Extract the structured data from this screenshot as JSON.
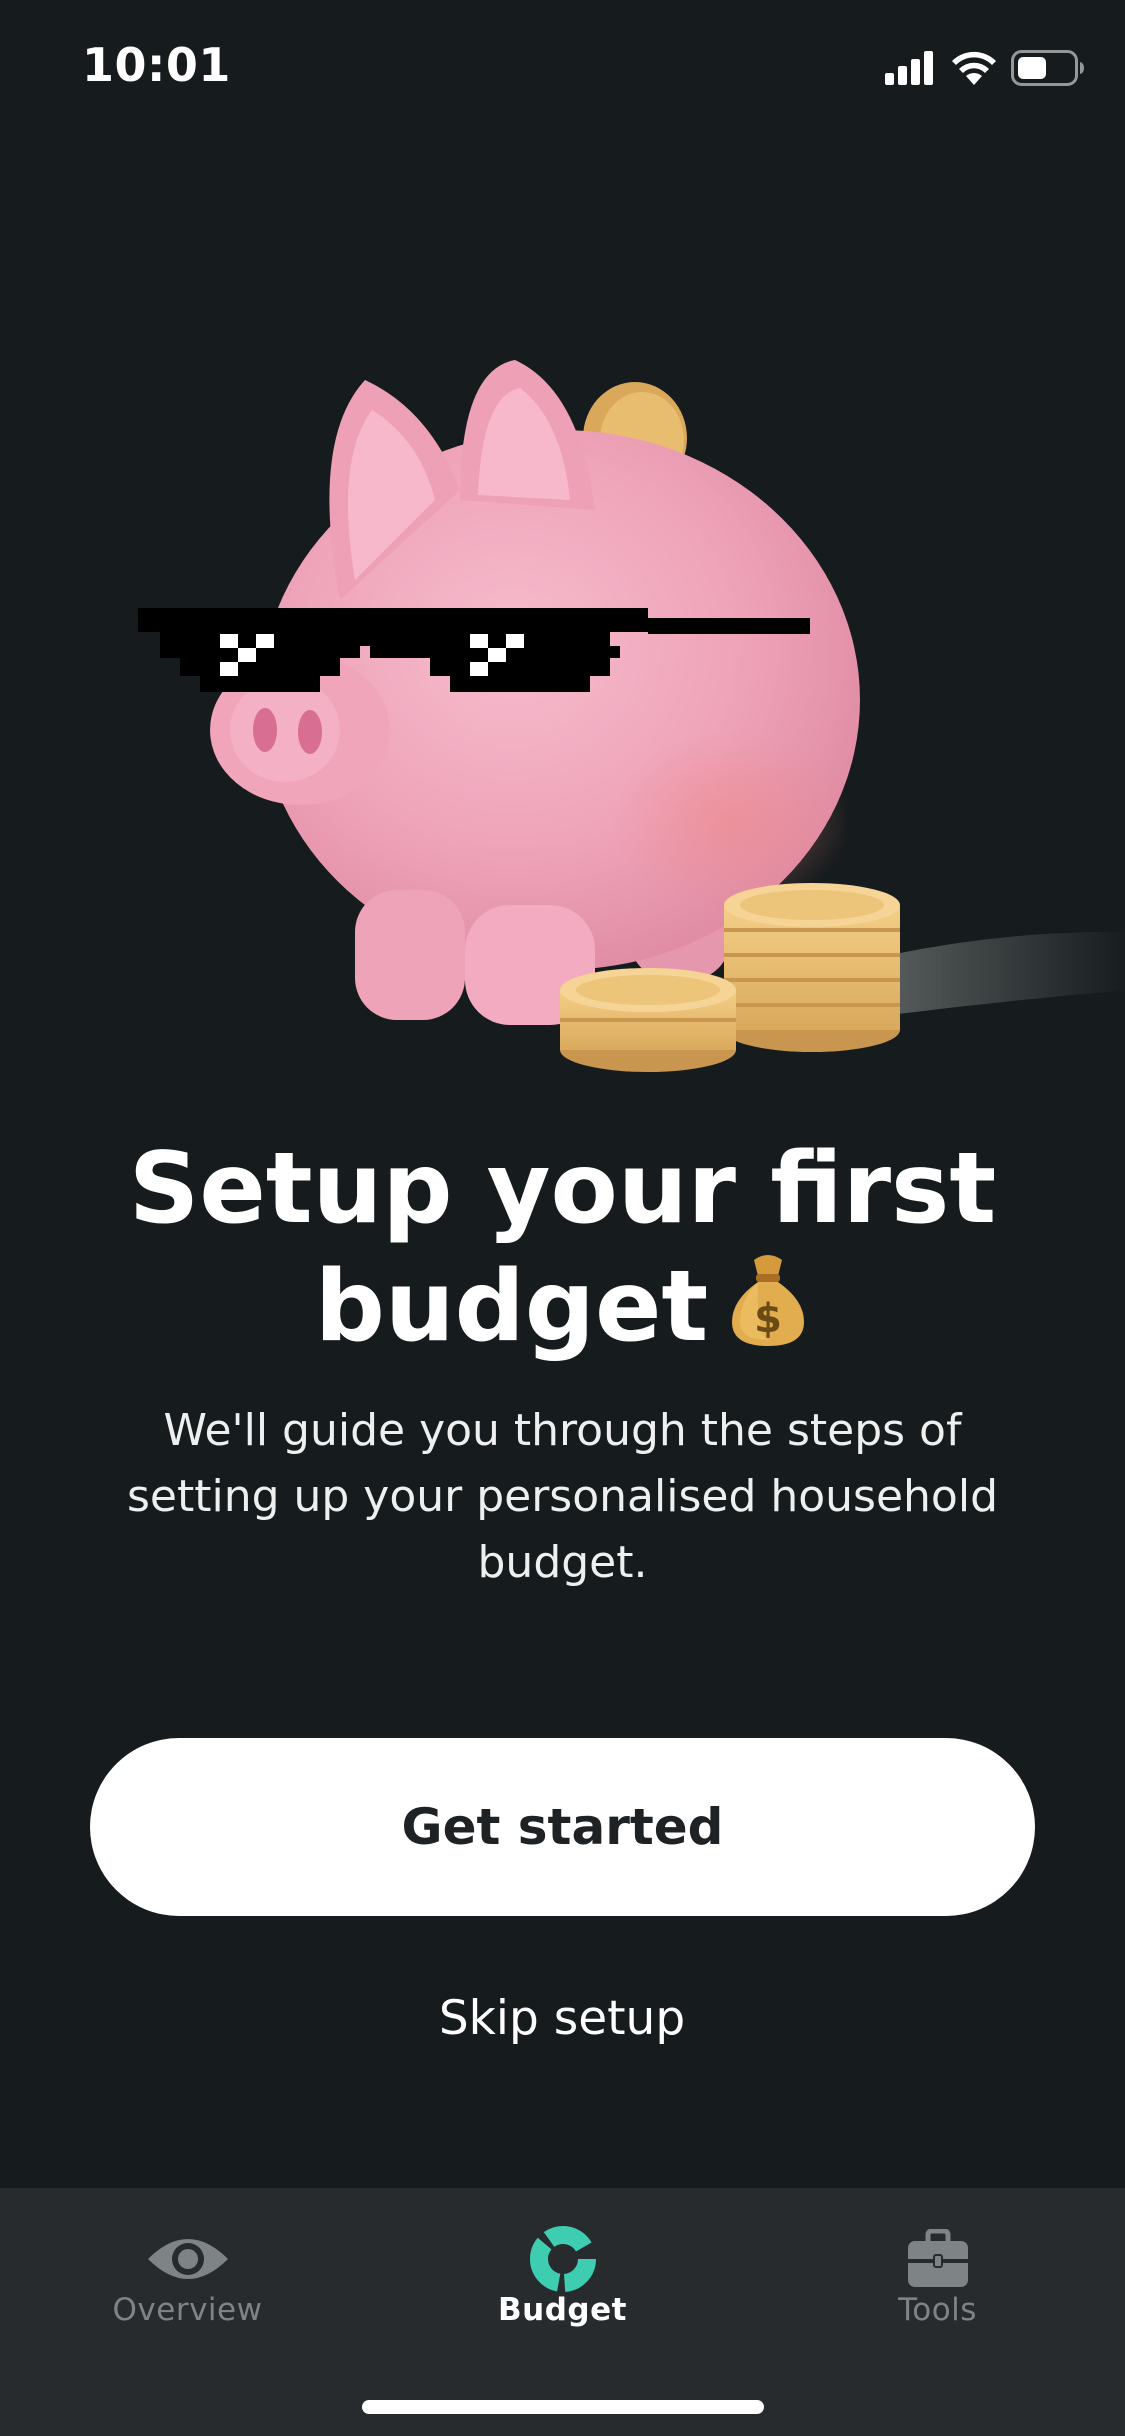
{
  "status_bar": {
    "time": "10:01",
    "icons": [
      "cellular-signal-icon",
      "wifi-icon",
      "battery-icon"
    ]
  },
  "hero": {
    "illustration": "piggy-bank-with-pixel-sunglasses-and-coins"
  },
  "content": {
    "title": "Setup your first budget",
    "title_emoji": "money-bag-icon",
    "subtitle": "We'll guide you through the steps of setting up your personalised household budget."
  },
  "actions": {
    "primary_label": "Get started",
    "secondary_label": "Skip setup"
  },
  "tab_bar": {
    "tabs": [
      {
        "label": "Overview",
        "icon": "eye-icon",
        "active": false
      },
      {
        "label": "Budget",
        "icon": "budget-ring-icon",
        "active": true
      },
      {
        "label": "Tools",
        "icon": "toolbox-icon",
        "active": false
      }
    ]
  },
  "colors": {
    "background": "#161b1d",
    "tab_bar": "#272b2e",
    "accent": "#3ecdb0",
    "inactive_tab": "#7e8386",
    "pig_pink": "#f2a6bd",
    "coin_gold": "#e8be72"
  }
}
